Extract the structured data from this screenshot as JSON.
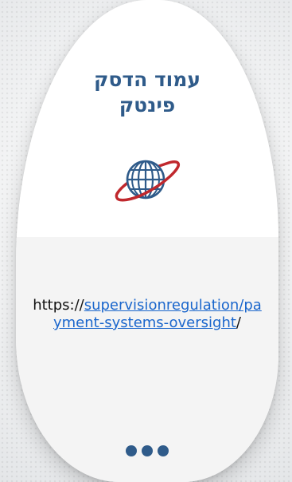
{
  "card": {
    "title_line1": "עמוד הדסק",
    "title_line2": "פינטק",
    "icon": "globe-icon",
    "url_prefix": "https://",
    "url_link": "supervisionregulation/payment-systems-oversight",
    "url_suffix": "/",
    "more_icon": "three-dots-icon"
  },
  "colors": {
    "accent": "#2f5b8a",
    "orbit": "#c0282d",
    "link": "#1a66cc"
  }
}
